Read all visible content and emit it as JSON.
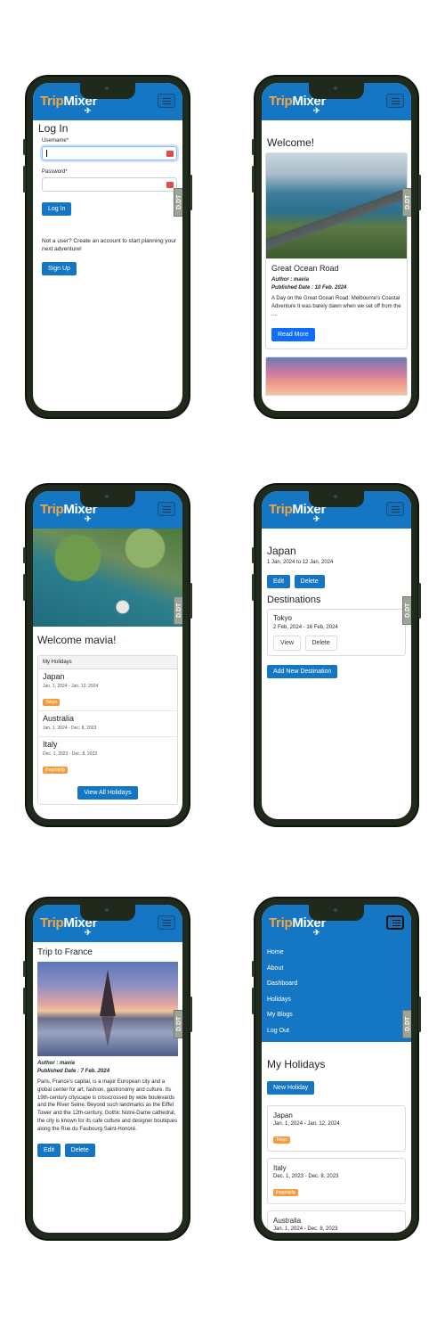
{
  "brand": {
    "name_part1": "Trip",
    "name_part2": "Mixer",
    "plane": "✈"
  },
  "badge_text": "D.DT",
  "login": {
    "title": "Log In",
    "username_label": "Username*",
    "password_label": "Password*",
    "login_button": "Log In",
    "signup_prompt": "Not a user? Create an account to start planning your next adventure!",
    "signup_button": "Sign Up"
  },
  "welcome": {
    "title": "Welcome!",
    "post_title": "Great Ocean Road",
    "author": "Author : mavia",
    "published": "Published Date : 10 Feb. 2024",
    "excerpt": "A Day on the Great Ocean Road: Melbourne's Coastal Adventure It was barely dawn when we set off from the ....",
    "read_more": "Read More"
  },
  "dashboard": {
    "title": "Welcome mavia!",
    "holidays_header": "My Holidays",
    "holidays": [
      {
        "name": "Japan",
        "dates": "Jan. 1, 2024 - Jan. 12, 2024",
        "tag": "Tokyo"
      },
      {
        "name": "Australia",
        "dates": "Jan. 1, 2024 - Dec. 8, 2023",
        "tag": ""
      },
      {
        "name": "Italy",
        "dates": "Dec. 1, 2023 - Dec. 8, 2023",
        "tag": "jhagdajdg"
      }
    ],
    "view_all": "View All Holidays"
  },
  "holiday_detail": {
    "title": "Japan",
    "dates": "1 Jan, 2024 to 12 Jan, 2024",
    "edit": "Edit",
    "delete": "Delete",
    "destinations_title": "Destinations",
    "destination_name": "Tokyo",
    "destination_dates": "2 Feb, 2024 - 16 Feb, 2024",
    "view": "View",
    "dest_delete": "Delete",
    "add_destination": "Add New Destination"
  },
  "blog": {
    "title": "Trip to France",
    "author": "Author : mavia",
    "published": "Published Date : 7 Feb. 2024",
    "body": "Paris, France's capital, is a major European city and a global center for art, fashion, gastronomy and culture. Its 19th-century cityscape is crisscrossed by wide boulevards and the River Seine. Beyond such landmarks as the Eiffel Tower and the 12th-century, Gothic Notre-Dame cathedral, the city is known for its cafe culture and designer boutiques along the Rue du Faubourg Saint-Honoré.",
    "edit": "Edit",
    "delete": "Delete"
  },
  "menu": {
    "items": [
      "Home",
      "About",
      "Dashboard",
      "Holidays",
      "My Blogs",
      "Log Out"
    ]
  },
  "holidays_list": {
    "title": "My Holidays",
    "new_button": "New Holiday",
    "items": [
      {
        "name": "Japan",
        "dates": "Jan. 1, 2024 - Jan. 12, 2024",
        "tag": "Tokyo"
      },
      {
        "name": "Italy",
        "dates": "Dec. 1, 2023 - Dec. 8, 2023",
        "tag": "jhagdajdg"
      },
      {
        "name": "Australia",
        "dates": "Jan. 1, 2024 - Dec. 8, 2023",
        "tag": ""
      }
    ]
  },
  "colors": {
    "primary": "#1577c4",
    "accent": "#f4a640",
    "badge": "#f39c3c",
    "phone": "#1f2a1c"
  }
}
